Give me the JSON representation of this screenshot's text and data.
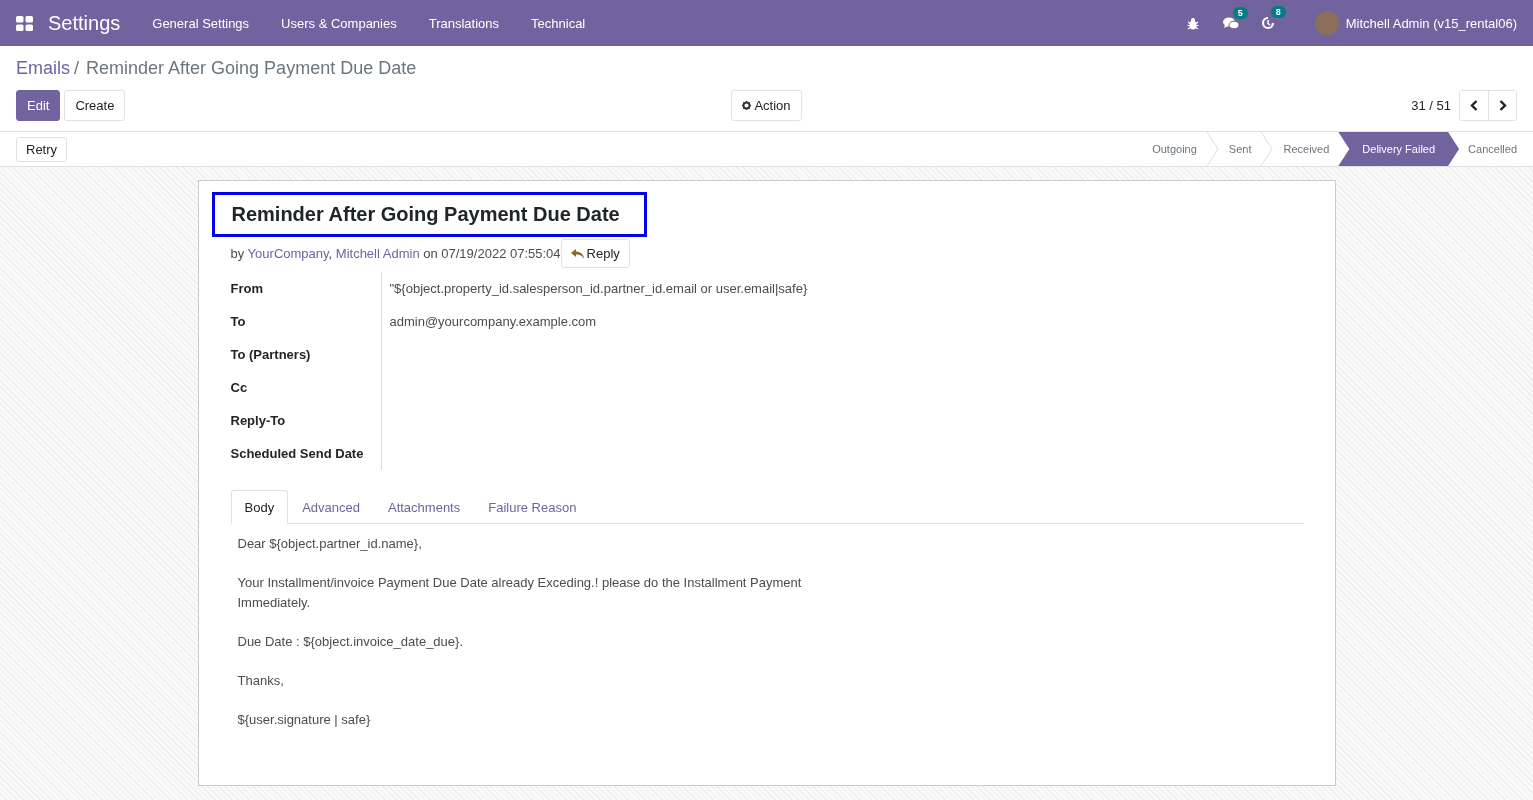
{
  "navbar": {
    "app_name": "Settings",
    "menu": [
      "General Settings",
      "Users & Companies",
      "Translations",
      "Technical"
    ],
    "messages_count": "5",
    "activities_count": "8",
    "user": "Mitchell Admin (v15_rental06)"
  },
  "breadcrumb": {
    "parent": "Emails",
    "separator": "/",
    "current": "Reminder After Going Payment Due Date"
  },
  "buttons": {
    "edit": "Edit",
    "create": "Create",
    "action": "Action"
  },
  "pager": {
    "value": "31 / 51"
  },
  "retry": "Retry",
  "statusbar": [
    {
      "label": "Outgoing",
      "selected": false
    },
    {
      "label": "Sent",
      "selected": false
    },
    {
      "label": "Received",
      "selected": false
    },
    {
      "label": "Delivery Failed",
      "selected": true
    },
    {
      "label": "Cancelled",
      "selected": false
    }
  ],
  "email": {
    "subject": "Reminder After Going Payment Due Date",
    "subject_highlighted": true,
    "author_line": [
      {
        "kind": "plain",
        "text": "by "
      },
      {
        "kind": "link",
        "text": "YourCompany"
      },
      {
        "kind": "plain",
        "text": ", "
      },
      {
        "kind": "link",
        "text": "Mitchell Admin"
      },
      {
        "kind": "plain",
        "text": " on 07/19/2022 07:55:04"
      }
    ],
    "reply": "Reply",
    "fields": [
      {
        "label": "From",
        "value": "\"${object.property_id.salesperson_id.partner_id.email or user.email|safe}"
      },
      {
        "label": "To",
        "value": "admin@yourcompany.example.com"
      },
      {
        "label": "To (Partners)"
      },
      {
        "label": "Cc"
      },
      {
        "label": "Reply-To"
      },
      {
        "label": "Scheduled Send Date"
      }
    ],
    "tabs": [
      {
        "label": "Body",
        "selected": true
      },
      {
        "label": "Advanced",
        "selected": false
      },
      {
        "label": "Attachments",
        "selected": false
      },
      {
        "label": "Failure Reason",
        "selected": false
      }
    ],
    "body": [
      "Dear ${object.partner_id.name},",
      "Your Installment/invoice Payment Due Date already Exceding.! please do the Installment Payment Immediately.",
      "Due Date : ${object.invoice_date_due}.",
      "Thanks,",
      "${user.signature | safe}"
    ]
  }
}
